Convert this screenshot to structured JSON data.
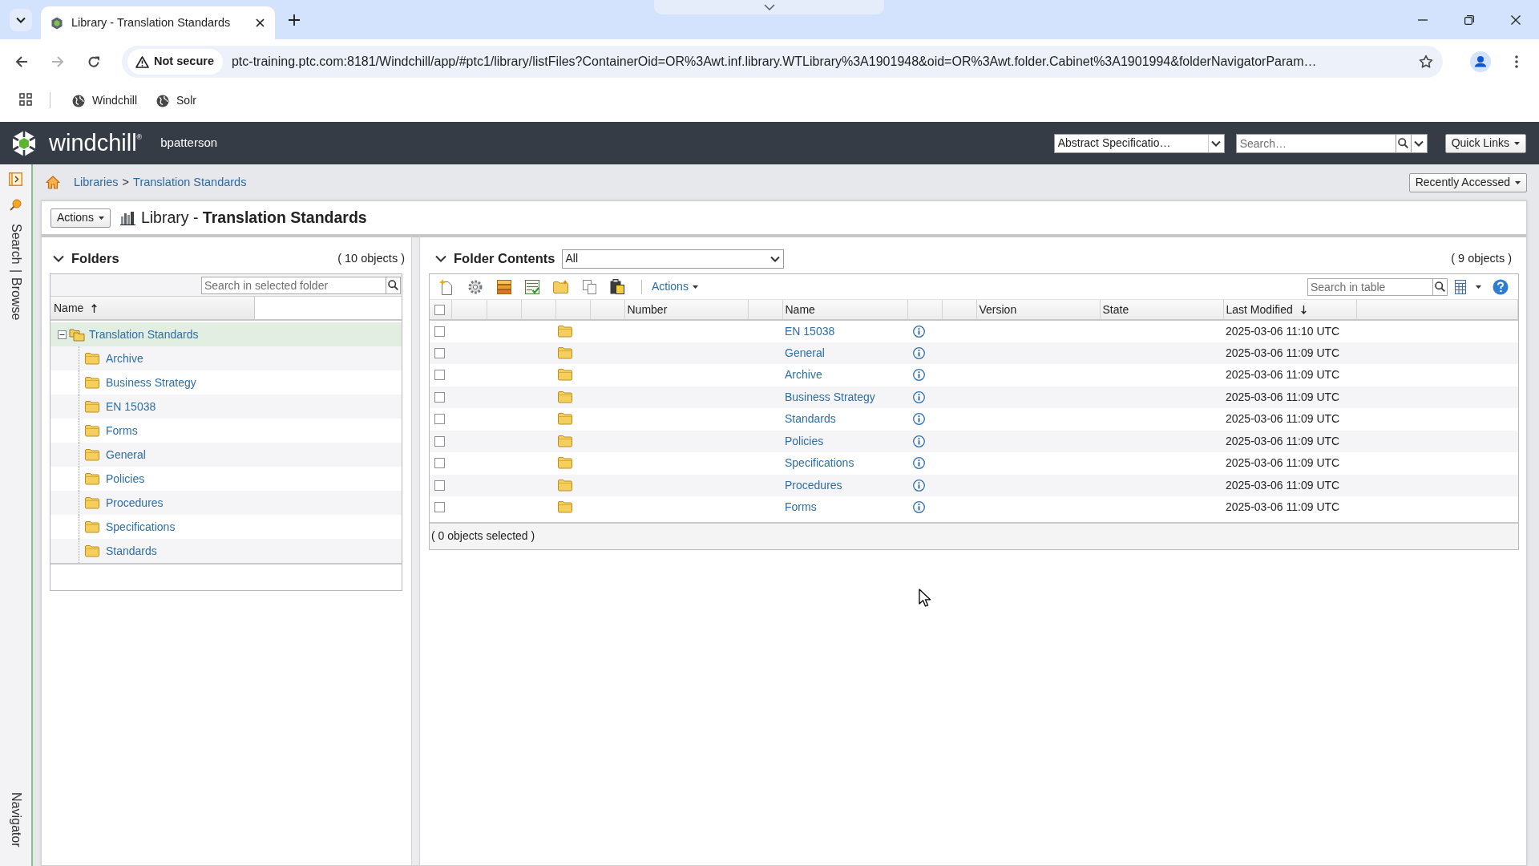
{
  "browser": {
    "tabs": [
      {
        "title": "Library - Translation Standards",
        "selected": true
      }
    ],
    "address_bar": {
      "security_label": "Not secure",
      "url": "ptc-training.ptc.com:8181/Windchill/app/#ptc1/library/listFiles?ContainerOid=OR%3Awt.inf.library.WTLibrary%3A1901948&oid=OR%3Awt.folder.Cabinet%3A1901994&folderNavigatorParam…"
    },
    "bookmarks": [
      {
        "label": "Windchill"
      },
      {
        "label": "Solr"
      }
    ]
  },
  "app_header": {
    "logo_text": "windchill$^{®}$",
    "user_name": "bpatterson",
    "context_select": "Abstract Specificatio…",
    "search": {
      "placeholder": "Search…"
    },
    "quick_links": "Quick Links"
  },
  "side_nav": {
    "links": [
      {
        "label": "Search"
      },
      {
        "label": "Browse"
      }
    ],
    "separator": "|",
    "navigator": "Navigator"
  },
  "breadcrumb": {
    "items": [
      {
        "label": "Libraries"
      },
      {
        "label": "Translation Standards"
      }
    ],
    "separator": ">"
  },
  "recently_accessed": "Recently Accessed",
  "page_title": {
    "actions": "Actions",
    "title": "Library - **Translation Standards**"
  },
  "folders_panel": {
    "title": "Folders",
    "expanded": true,
    "count": "( 10 objects )",
    "search": {
      "placeholder": "Search in selected folder"
    },
    "name_column": {
      "label": "Name",
      "sorted": true,
      "descending": false
    },
    "tree": [
      {
        "label": "Translation Standards",
        "kind": "cabinet",
        "expanded": true,
        "selected": true,
        "children": [
          {
            "label": "Archive",
            "kind": "folder",
            "selected": false
          },
          {
            "label": "Business Strategy",
            "kind": "folder",
            "selected": false
          },
          {
            "label": "EN 15038",
            "kind": "folder",
            "selected": false
          },
          {
            "label": "Forms",
            "kind": "folder",
            "selected": false
          },
          {
            "label": "General",
            "kind": "folder",
            "selected": false
          },
          {
            "label": "Policies",
            "kind": "folder",
            "selected": false
          },
          {
            "label": "Procedures",
            "kind": "folder",
            "selected": false
          },
          {
            "label": "Specifications",
            "kind": "folder",
            "selected": false
          },
          {
            "label": "Standards",
            "kind": "folder",
            "selected": false
          }
        ]
      }
    ]
  },
  "folder_contents": {
    "title": "Folder Contents",
    "expanded": true,
    "filter": "All",
    "count": "( 9 objects )",
    "actions": "Actions",
    "search": {
      "placeholder": "Search in table"
    },
    "select_all_checked": false,
    "columns": [
      {
        "label": "Number",
        "sorted": false
      },
      {
        "label": "Name",
        "sorted": false
      },
      {
        "label": "Version",
        "sorted": false
      },
      {
        "label": "State",
        "sorted": false
      },
      {
        "label": "Last Modified",
        "sorted": true,
        "descending": true
      }
    ],
    "rows": [
      {
        "checked": false,
        "name": "EN 15038",
        "last_modified": "2025-03-06 11:10 UTC"
      },
      {
        "checked": false,
        "name": "General",
        "last_modified": "2025-03-06 11:09 UTC"
      },
      {
        "checked": false,
        "name": "Archive",
        "last_modified": "2025-03-06 11:09 UTC"
      },
      {
        "checked": false,
        "name": "Business Strategy",
        "last_modified": "2025-03-06 11:09 UTC"
      },
      {
        "checked": false,
        "name": "Standards",
        "last_modified": "2025-03-06 11:09 UTC"
      },
      {
        "checked": false,
        "name": "Policies",
        "last_modified": "2025-03-06 11:09 UTC"
      },
      {
        "checked": false,
        "name": "Specifications",
        "last_modified": "2025-03-06 11:09 UTC"
      },
      {
        "checked": false,
        "name": "Procedures",
        "last_modified": "2025-03-06 11:09 UTC"
      },
      {
        "checked": false,
        "name": "Forms",
        "last_modified": "2025-03-06 11:09 UTC"
      }
    ],
    "selection_summary": "( 0 objects selected )"
  }
}
